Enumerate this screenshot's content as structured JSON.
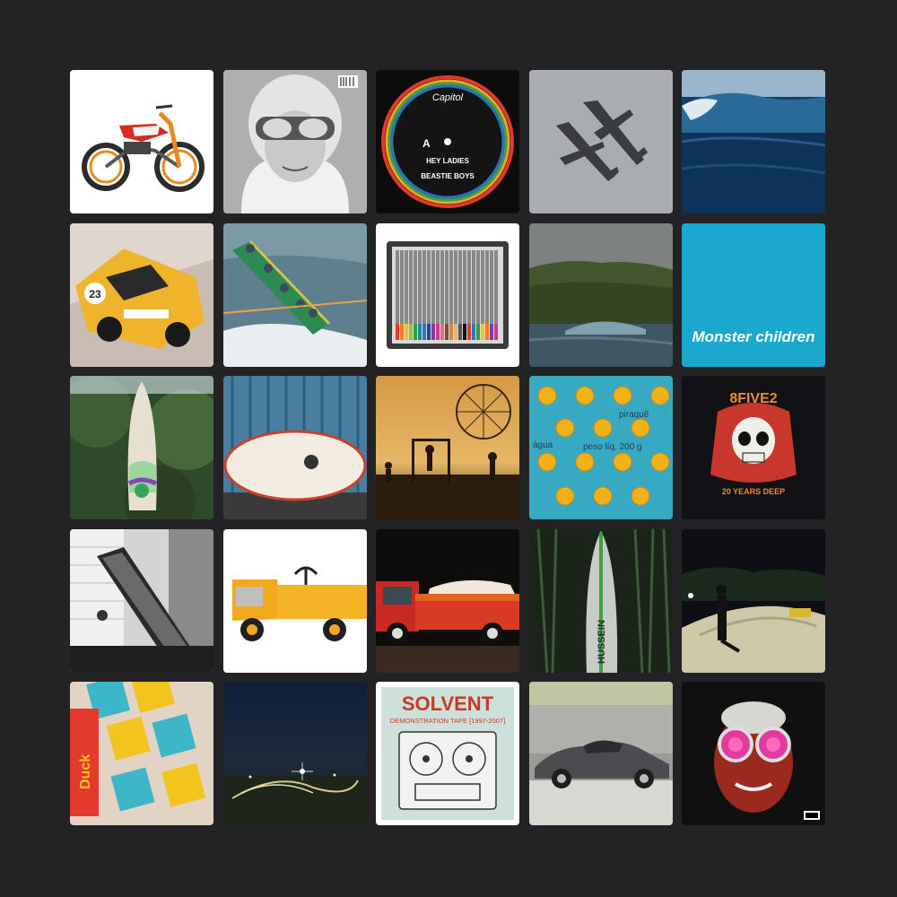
{
  "tiles": [
    {
      "name": "trial-motorcycle",
      "texts": {}
    },
    {
      "name": "helmet-goggles-portrait",
      "texts": {}
    },
    {
      "name": "vinyl-record-label",
      "texts": {
        "brand": "Capitol",
        "side": "A",
        "title": "HEY LADIES",
        "artist": "BEASTIE BOYS"
      }
    },
    {
      "name": "spitfire-planes",
      "texts": {}
    },
    {
      "name": "ocean-wave",
      "texts": {}
    },
    {
      "name": "yellow-race-car",
      "texts": {
        "number": "23"
      }
    },
    {
      "name": "surf-boat",
      "texts": {}
    },
    {
      "name": "colored-pencils-tin",
      "texts": {}
    },
    {
      "name": "island-wave",
      "texts": {}
    },
    {
      "name": "monster-children-logo",
      "texts": {
        "logo": "Monster children"
      }
    },
    {
      "name": "surfboard-in-trees",
      "texts": {}
    },
    {
      "name": "surfboard-on-container",
      "texts": {}
    },
    {
      "name": "fairground-silhouettes",
      "texts": {}
    },
    {
      "name": "piraque-pattern",
      "texts": {
        "brand": "piraquê",
        "agua": "água",
        "weight": "peso líq. 200 g"
      }
    },
    {
      "name": "skull-tshirt",
      "texts": {
        "top": "8FIVE2",
        "bottom": "20 YEARS DEEP"
      }
    },
    {
      "name": "escalator-building",
      "texts": {}
    },
    {
      "name": "yellow-utility-cart",
      "texts": {}
    },
    {
      "name": "red-truck-with-car",
      "texts": {}
    },
    {
      "name": "surfboard-bamboo",
      "texts": {
        "board": "HUSSEIN"
      }
    },
    {
      "name": "night-skatepark",
      "texts": {}
    },
    {
      "name": "duck-gum-packs",
      "texts": {
        "brand": "Duck"
      }
    },
    {
      "name": "night-race-track",
      "texts": {}
    },
    {
      "name": "solvent-tape-cover",
      "texts": {
        "title": "SOLVENT",
        "subtitle": "DEMONSTRATION TAPE [1997-2007]"
      }
    },
    {
      "name": "grey-e-type",
      "texts": {}
    },
    {
      "name": "red-goggles-face",
      "texts": {}
    }
  ]
}
